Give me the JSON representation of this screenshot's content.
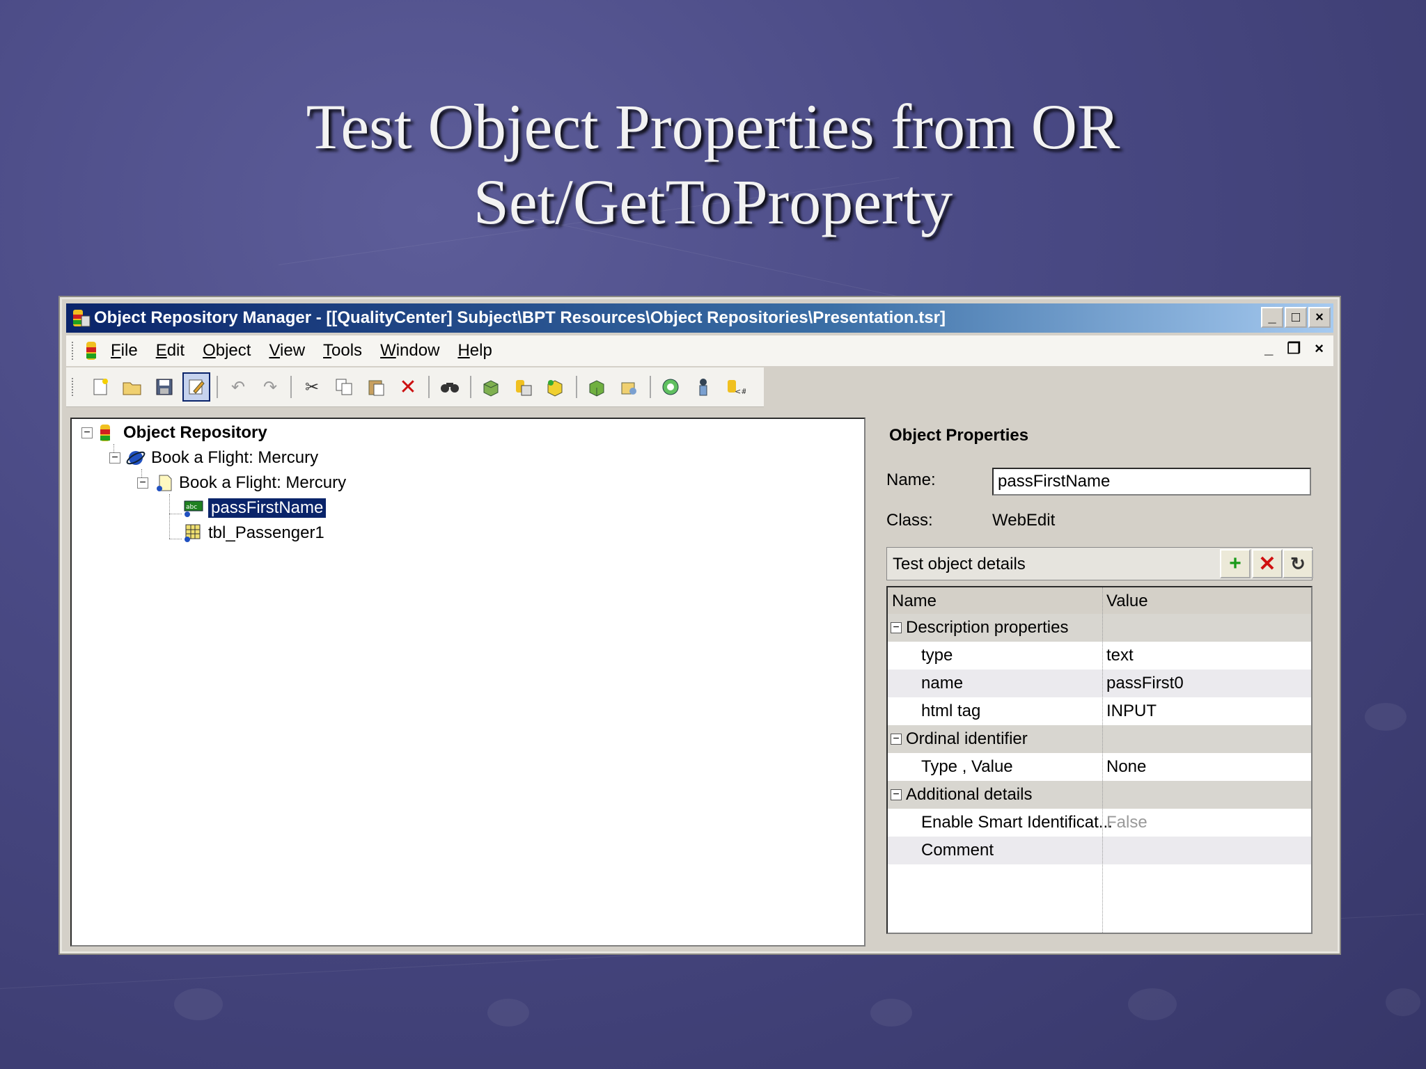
{
  "slide": {
    "title_line1": "Test Object Properties from OR",
    "title_line2": "Set/GetToProperty"
  },
  "window": {
    "title": "Object Repository Manager - [[QualityCenter] Subject\\BPT Resources\\Object Repositories\\Presentation.tsr]",
    "buttons": {
      "minimize": "_",
      "maximize": "□",
      "close": "×"
    }
  },
  "menu": {
    "items": [
      {
        "label": "File",
        "u": "F",
        "rest": "ile"
      },
      {
        "label": "Edit",
        "u": "E",
        "rest": "dit"
      },
      {
        "label": "Object",
        "u": "O",
        "rest": "bject"
      },
      {
        "label": "View",
        "u": "V",
        "rest": "iew"
      },
      {
        "label": "Tools",
        "u": "T",
        "rest": "ools"
      },
      {
        "label": "Window",
        "u": "W",
        "rest": "indow"
      },
      {
        "label": "Help",
        "u": "H",
        "rest": "elp"
      }
    ],
    "mdi": {
      "minimize": "_",
      "restore": "❐",
      "close": "×"
    }
  },
  "toolbar": {
    "icons": [
      "new-icon",
      "open-icon",
      "save-icon",
      "edit-icon",
      "undo-icon",
      "redo-icon",
      "cut-icon",
      "copy-icon",
      "paste-icon",
      "delete-icon",
      "find-icon",
      "add-objects-icon",
      "export-icon",
      "merge-icon",
      "local-objects-icon",
      "associate-icon",
      "highlight-icon",
      "object-spy-icon",
      "parameters-icon"
    ]
  },
  "tree": {
    "root": "Object Repository",
    "browser": "Book a Flight: Mercury",
    "page": "Book a Flight: Mercury",
    "selected": "passFirstName",
    "table": "tbl_Passenger1"
  },
  "properties": {
    "panel_title": "Object Properties",
    "name_label": "Name:",
    "name_value": "passFirstName",
    "class_label": "Class:",
    "class_value": "WebEdit",
    "details_label": "Test object details",
    "col_name": "Name",
    "col_value": "Value",
    "rows": [
      {
        "name": "Description properties",
        "value": "",
        "group": true
      },
      {
        "name": "type",
        "value": "text"
      },
      {
        "name": "name",
        "value": "passFirst0"
      },
      {
        "name": "html tag",
        "value": "INPUT"
      },
      {
        "name": "Ordinal identifier",
        "value": "",
        "group": true
      },
      {
        "name": "Type , Value",
        "value": "None"
      },
      {
        "name": "Additional details",
        "value": "",
        "group": true
      },
      {
        "name": "Enable Smart Identificat...",
        "value": "False"
      },
      {
        "name": "Comment",
        "value": ""
      }
    ]
  }
}
